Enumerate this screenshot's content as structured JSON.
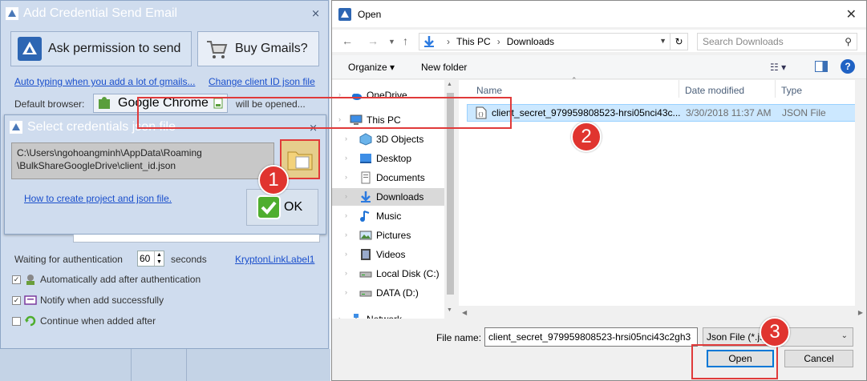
{
  "email_window": {
    "title": "Add Credential Send Email",
    "close_icon": "close-icon",
    "ask_permission_label": "Ask permission to send",
    "buy_gmails_label": "Buy Gmails?",
    "auto_typing_link": "Auto typing when you add a lot of gmails...",
    "change_client_link": "Change client ID json file",
    "default_browser_label": "Default browser:",
    "browser_name": "Google Chrome",
    "will_be_opened": "will be opened...",
    "waiting_label": "Waiting for authentication",
    "wait_seconds": "60",
    "seconds_label": "seconds",
    "krypton_link": "KryptonLinkLabel1",
    "auto_add_label": "Automatically add after authentication",
    "notify_label": "Notify when add successfully",
    "continue_label": "Continue when added after",
    "auto_add_checked": true,
    "notify_checked": true,
    "continue_checked": false
  },
  "cred_dialog": {
    "title": "Select credentials json file",
    "path_line1": "C:\\Users\\ngohoangminh\\AppData\\Roaming",
    "path_line2": "\\BulkShareGoogleDrive\\client_id.json",
    "howto_link": "How to create project and json file.",
    "ok_label": "OK"
  },
  "markers": [
    "1",
    "2",
    "3"
  ],
  "open_dialog": {
    "title": "Open",
    "breadcrumb": [
      "This PC",
      "Downloads"
    ],
    "search_placeholder": "Search Downloads",
    "organize_label": "Organize",
    "new_folder_label": "New folder",
    "nav_items": [
      {
        "label": "OneDrive",
        "icon": "cloud-icon",
        "indent": 0
      },
      {
        "label": "This PC",
        "icon": "computer-icon",
        "indent": 0
      },
      {
        "label": "3D Objects",
        "icon": "cube-icon",
        "indent": 1
      },
      {
        "label": "Desktop",
        "icon": "desktop-icon",
        "indent": 1
      },
      {
        "label": "Documents",
        "icon": "documents-icon",
        "indent": 1
      },
      {
        "label": "Downloads",
        "icon": "download-icon",
        "indent": 1,
        "selected": true
      },
      {
        "label": "Music",
        "icon": "music-icon",
        "indent": 1
      },
      {
        "label": "Pictures",
        "icon": "pictures-icon",
        "indent": 1
      },
      {
        "label": "Videos",
        "icon": "video-icon",
        "indent": 1
      },
      {
        "label": "Local Disk (C:)",
        "icon": "disk-icon",
        "indent": 1
      },
      {
        "label": "DATA (D:)",
        "icon": "disk-icon",
        "indent": 1
      },
      {
        "label": "Network",
        "icon": "network-icon",
        "indent": 0
      }
    ],
    "columns": {
      "name": "Name",
      "date": "Date modified",
      "type": "Type"
    },
    "files": [
      {
        "name": "client_secret_979959808523-hrsi05nci43c...",
        "date": "3/30/2018 11:37 AM",
        "type": "JSON File"
      }
    ],
    "file_name_label": "File name:",
    "file_name_value": "client_secret_979959808523-hrsi05nci43c2gh3",
    "file_type_value": "Json File (*.json)",
    "open_label": "Open",
    "cancel_label": "Cancel"
  },
  "colors": {
    "marker_red": "#e0342f",
    "link_blue": "#1a4fcc",
    "selection_blue": "#cce8ff"
  }
}
